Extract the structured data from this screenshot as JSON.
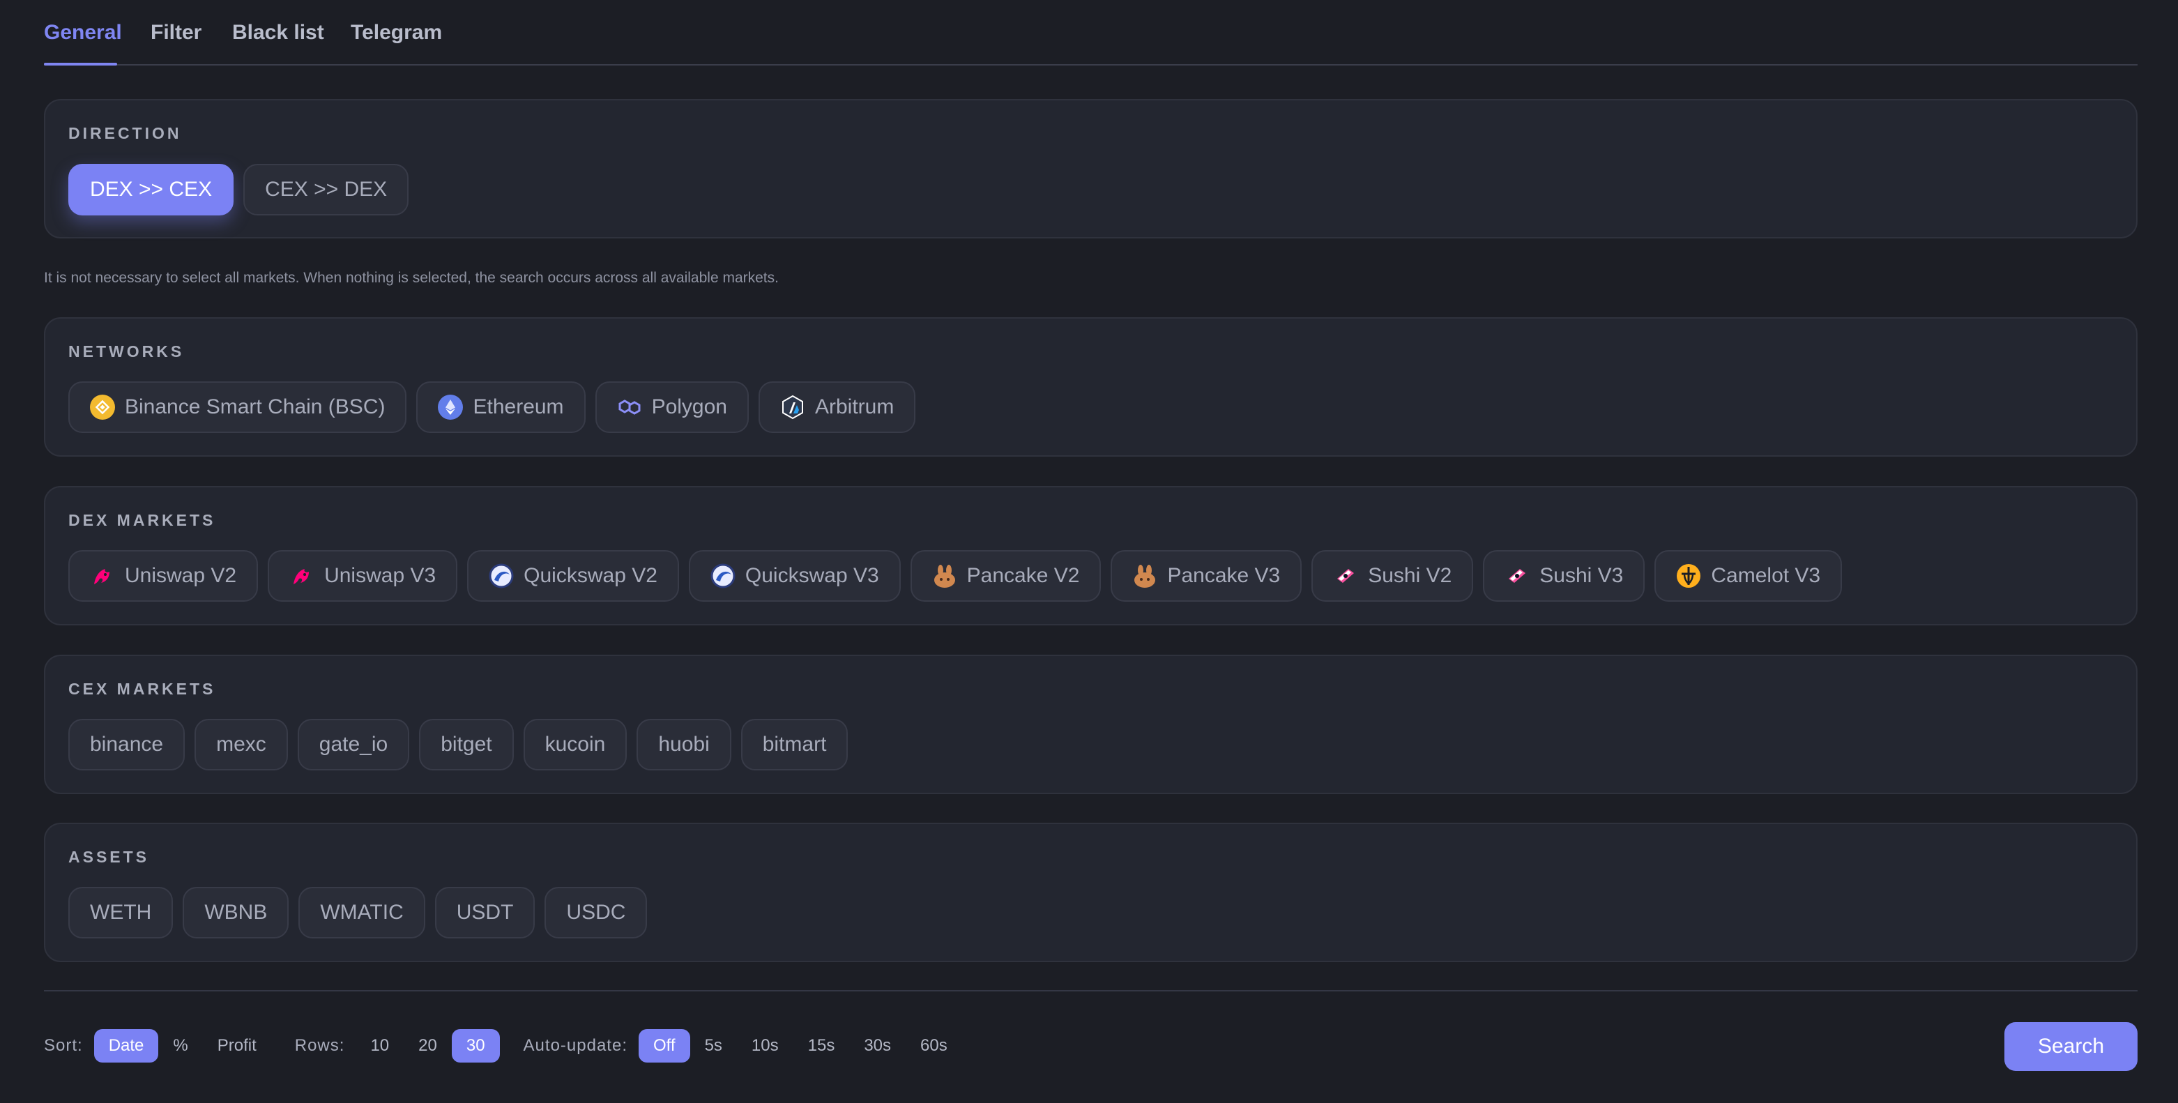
{
  "tabs": [
    {
      "label": "General",
      "active": true
    },
    {
      "label": "Filter",
      "active": false
    },
    {
      "label": "Black list",
      "active": false
    },
    {
      "label": "Telegram",
      "active": false
    }
  ],
  "direction": {
    "title": "DIRECTION",
    "options": [
      {
        "label": "DEX >> CEX",
        "selected": true
      },
      {
        "label": "CEX >> DEX",
        "selected": false
      }
    ]
  },
  "note": "It is not necessary to select all markets. When nothing is selected, the search occurs across all available markets.",
  "networks": {
    "title": "NETWORKS",
    "items": [
      {
        "label": "Binance Smart Chain (BSC)",
        "icon": "bsc-icon"
      },
      {
        "label": "Ethereum",
        "icon": "ethereum-icon"
      },
      {
        "label": "Polygon",
        "icon": "polygon-icon"
      },
      {
        "label": "Arbitrum",
        "icon": "arbitrum-icon"
      }
    ]
  },
  "dex_markets": {
    "title": "DEX MARKETS",
    "items": [
      {
        "label": "Uniswap V2",
        "icon": "uniswap-icon"
      },
      {
        "label": "Uniswap V3",
        "icon": "uniswap-icon"
      },
      {
        "label": "Quickswap V2",
        "icon": "quickswap-icon"
      },
      {
        "label": "Quickswap V3",
        "icon": "quickswap-icon"
      },
      {
        "label": "Pancake V2",
        "icon": "pancake-icon"
      },
      {
        "label": "Pancake V3",
        "icon": "pancake-icon"
      },
      {
        "label": "Sushi V2",
        "icon": "sushi-icon"
      },
      {
        "label": "Sushi V3",
        "icon": "sushi-icon"
      },
      {
        "label": "Camelot V3",
        "icon": "camelot-icon"
      }
    ]
  },
  "cex_markets": {
    "title": "CEX MARKETS",
    "items": [
      "binance",
      "mexc",
      "gate_io",
      "bitget",
      "kucoin",
      "huobi",
      "bitmart"
    ]
  },
  "assets": {
    "title": "ASSETS",
    "items": [
      "WETH",
      "WBNB",
      "WMATIC",
      "USDT",
      "USDC"
    ]
  },
  "controls": {
    "sort_label": "Sort:",
    "sort_options": [
      "Date",
      "%",
      "Profit"
    ],
    "sort_selected": "Date",
    "rows_label": "Rows:",
    "rows_options": [
      "10",
      "20",
      "30"
    ],
    "rows_selected": "30",
    "autoupdate_label": "Auto-update:",
    "autoupdate_options": [
      "Off",
      "5s",
      "10s",
      "15s",
      "30s",
      "60s"
    ],
    "autoupdate_selected": "Off",
    "search_label": "Search"
  },
  "colors": {
    "accent": "#7b82f4",
    "background": "#1c1e25",
    "panel": "#232630"
  }
}
